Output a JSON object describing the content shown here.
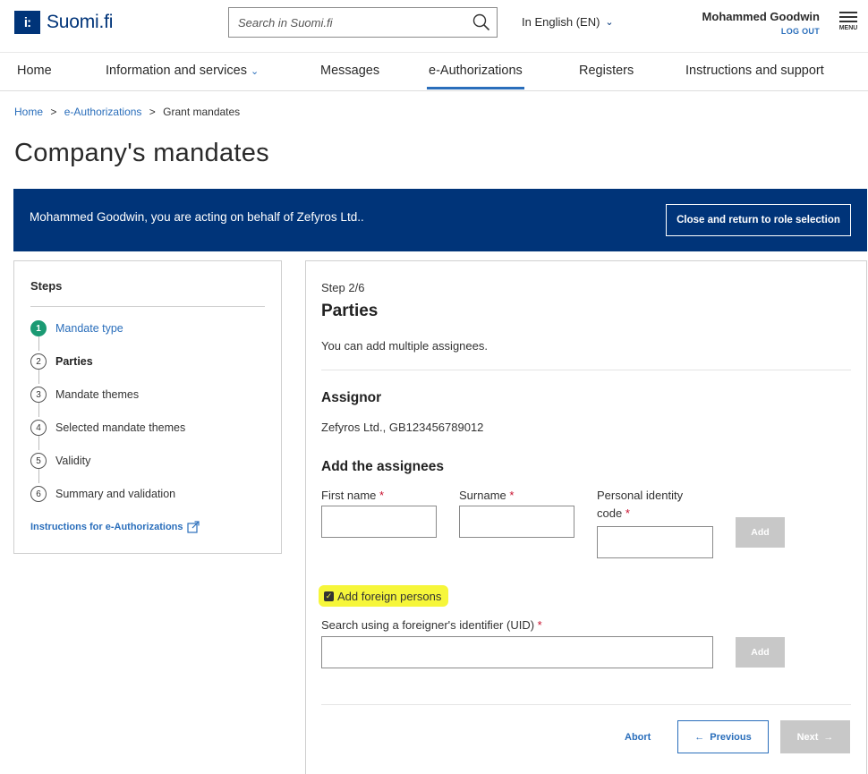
{
  "header": {
    "logo_mark": "i:",
    "logo_text": "Suomi.fi",
    "search_placeholder": "Search in Suomi.fi",
    "language": "In English (EN)",
    "user_name": "Mohammed Goodwin",
    "logout": "LOG OUT",
    "menu": "MENU"
  },
  "nav": {
    "items": [
      {
        "label": "Home"
      },
      {
        "label": "Information and services"
      },
      {
        "label": "Messages"
      },
      {
        "label": "e-Authorizations"
      },
      {
        "label": "Registers"
      },
      {
        "label": "Instructions and support"
      }
    ],
    "active": "e-Authorizations"
  },
  "breadcrumb": {
    "items": [
      "Home",
      "e-Authorizations",
      "Grant mandates"
    ],
    "separator": ">"
  },
  "page_title": "Company's mandates",
  "banner": {
    "text": "Mohammed Goodwin, you are acting on behalf of Zefyros Ltd..",
    "button": "Close and return to role selection"
  },
  "steps": {
    "title": "Steps",
    "items": [
      {
        "num": "1",
        "label": "Mandate type"
      },
      {
        "num": "2",
        "label": "Parties"
      },
      {
        "num": "3",
        "label": "Mandate themes"
      },
      {
        "num": "4",
        "label": "Selected mandate themes"
      },
      {
        "num": "5",
        "label": "Validity"
      },
      {
        "num": "6",
        "label": "Summary and validation"
      }
    ],
    "instructions_link": "Instructions for e-Authorizations"
  },
  "form": {
    "step_counter": "Step 2/6",
    "heading": "Parties",
    "description": "You can add multiple assignees.",
    "assignor_heading": "Assignor",
    "assignor_value": "Zefyros Ltd., GB123456789012",
    "assignees_heading": "Add the assignees",
    "first_name_label": "First name",
    "surname_label": "Surname",
    "pic_label_1": "Personal identity",
    "pic_label_2": "code",
    "required_mark": "*",
    "add_label": "Add",
    "foreign_checkbox": "Add foreign persons",
    "foreign_checked": true,
    "uid_label": "Search using a foreigner's identifier (UID)",
    "abort": "Abort",
    "previous": "Previous",
    "next": "Next",
    "arrow_left": "←",
    "arrow_right": "→"
  },
  "colors": {
    "brand": "#003479",
    "link": "#2a6ebb",
    "step_done": "#1a9a73",
    "highlight": "#f6f63a",
    "disabled": "#c8c8c8"
  }
}
